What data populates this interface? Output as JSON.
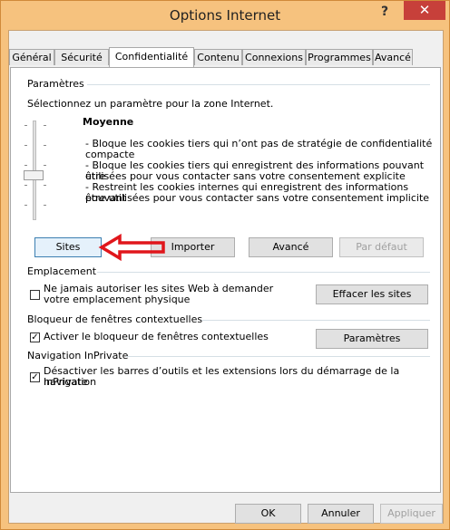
{
  "window": {
    "title": "Options Internet",
    "help": "?",
    "close": "✕"
  },
  "tabs": [
    "Général",
    "Sécurité",
    "Confidentialité",
    "Contenu",
    "Connexions",
    "Programmes",
    "Avancé"
  ],
  "parametres": {
    "heading": "Paramètres",
    "prompt": "Sélectionnez un paramètre pour la zone Internet.",
    "level": "Moyenne",
    "desc": [
      "- Bloque les cookies tiers qui n’ont pas de stratégie de confidentialité",
      "compacte",
      "- Bloque les cookies tiers qui enregistrent des informations pouvant être",
      "utilisées pour vous contacter sans votre consentement explicite",
      "- Restreint les cookies internes qui enregistrent des informations pouvant",
      "être utilisées pour vous contacter sans votre consentement implicite"
    ],
    "buttons": {
      "sites": "Sites",
      "importer": "Importer",
      "avance": "Avancé",
      "par_defaut": "Par défaut"
    }
  },
  "emplacement": {
    "heading": "Emplacement",
    "checkbox_line1": "Ne jamais autoriser les sites Web à demander",
    "checkbox_line2": "votre emplacement physique",
    "checked": false,
    "clear_button": "Effacer les sites"
  },
  "bloqueur": {
    "heading": "Bloqueur de fenêtres contextuelles",
    "checkbox": "Activer le bloqueur de fenêtres contextuelles",
    "checked": true,
    "button": "Paramètres"
  },
  "inprivate": {
    "heading": "Navigation InPrivate",
    "checkbox_line1": "Désactiver les barres d’outils et les extensions lors du démarrage de la navigation",
    "checkbox_line2": "InPrivate",
    "checked": true
  },
  "footer": {
    "ok": "OK",
    "annuler": "Annuler",
    "appliquer": "Appliquer"
  },
  "colors": {
    "accent": "#3c7fb1",
    "arrow": "#e0161b",
    "titlebar": "#f6c27e",
    "close": "#c7403a"
  }
}
